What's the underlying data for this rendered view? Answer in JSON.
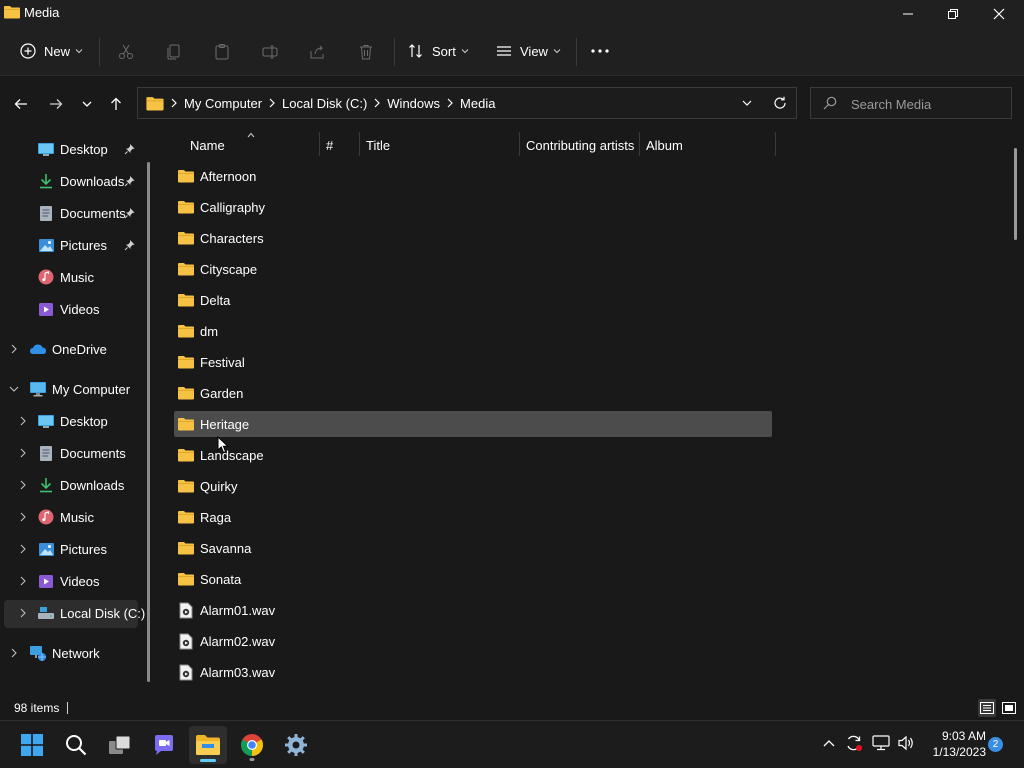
{
  "window": {
    "title": "Media"
  },
  "toolbar": {
    "new_label": "New",
    "sort_label": "Sort",
    "view_label": "View",
    "more_label": "···"
  },
  "address": {
    "crumbs": [
      "My Computer",
      "Local Disk (C:)",
      "Windows",
      "Media"
    ],
    "search_placeholder": "Search Media"
  },
  "nav": {
    "quick_access": [
      {
        "label": "Desktop",
        "icon": "desktop-icon",
        "pinned": true
      },
      {
        "label": "Downloads",
        "icon": "download-icon",
        "pinned": true
      },
      {
        "label": "Documents",
        "icon": "documents-icon",
        "pinned": true
      },
      {
        "label": "Pictures",
        "icon": "pictures-icon",
        "pinned": true
      },
      {
        "label": "Music",
        "icon": "music-icon",
        "pinned": false
      },
      {
        "label": "Videos",
        "icon": "videos-icon",
        "pinned": false
      }
    ],
    "onedrive": "OneDrive",
    "my_computer": "My Computer",
    "computer_children": [
      {
        "label": "Desktop",
        "icon": "desktop-icon"
      },
      {
        "label": "Documents",
        "icon": "documents-icon"
      },
      {
        "label": "Downloads",
        "icon": "download-icon"
      },
      {
        "label": "Music",
        "icon": "music-icon"
      },
      {
        "label": "Pictures",
        "icon": "pictures-icon"
      },
      {
        "label": "Videos",
        "icon": "videos-icon"
      },
      {
        "label": "Local Disk (C:)",
        "icon": "drive-icon"
      }
    ],
    "network": "Network"
  },
  "columns": {
    "name": "Name",
    "number": "#",
    "title": "Title",
    "artists": "Contributing artists",
    "album": "Album"
  },
  "files": [
    {
      "name": "Afternoon",
      "type": "folder"
    },
    {
      "name": "Calligraphy",
      "type": "folder"
    },
    {
      "name": "Characters",
      "type": "folder"
    },
    {
      "name": "Cityscape",
      "type": "folder"
    },
    {
      "name": "Delta",
      "type": "folder"
    },
    {
      "name": "dm",
      "type": "folder"
    },
    {
      "name": "Festival",
      "type": "folder"
    },
    {
      "name": "Garden",
      "type": "folder"
    },
    {
      "name": "Heritage",
      "type": "folder",
      "selected": true
    },
    {
      "name": "Landscape",
      "type": "folder"
    },
    {
      "name": "Quirky",
      "type": "folder"
    },
    {
      "name": "Raga",
      "type": "folder"
    },
    {
      "name": "Savanna",
      "type": "folder"
    },
    {
      "name": "Sonata",
      "type": "folder"
    },
    {
      "name": "Alarm01.wav",
      "type": "audio"
    },
    {
      "name": "Alarm02.wav",
      "type": "audio"
    },
    {
      "name": "Alarm03.wav",
      "type": "audio"
    }
  ],
  "status": {
    "item_count": "98 items"
  },
  "taskbar": {
    "apps": [
      "start-icon",
      "search-icon",
      "task-view-icon",
      "teams-chat-icon",
      "file-explorer-icon",
      "chrome-icon",
      "settings-icon"
    ],
    "time": "9:03 AM",
    "date": "1/13/2023",
    "notifications": "2"
  },
  "colors": {
    "background": "#191919",
    "chrome": "#202020",
    "selected_row": "#4c4c4c",
    "folder": "#f6c244",
    "accent": "#60cdff"
  }
}
